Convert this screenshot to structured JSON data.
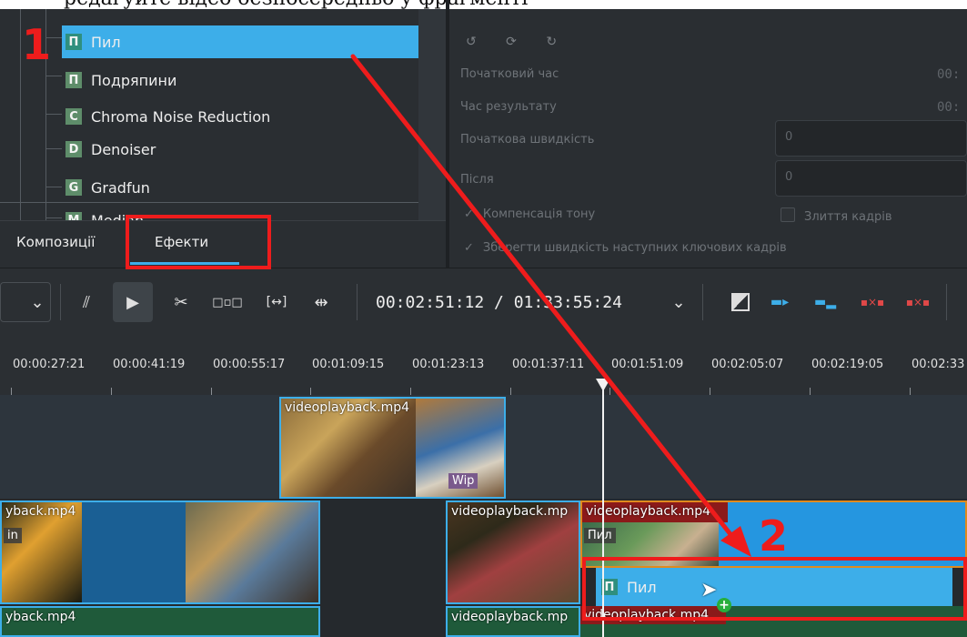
{
  "header_caption": "редагуйте відео безпосередньо у фрагменті",
  "effects_list": {
    "items": [
      {
        "badge": "П",
        "label": "Пил",
        "selected": true
      },
      {
        "badge": "П",
        "label": "Подряпини"
      },
      {
        "badge": "C",
        "label": "Chroma Noise Reduction"
      },
      {
        "badge": "D",
        "label": "Denoiser"
      },
      {
        "badge": "G",
        "label": "Gradfun"
      },
      {
        "badge": "M",
        "label": "Median"
      }
    ]
  },
  "tabs": [
    {
      "label": "Композиції"
    },
    {
      "label": "Ефекти",
      "active": true
    }
  ],
  "properties": {
    "start_time_label": "Початковий час",
    "start_time_value": "00:",
    "result_time_label": "Час результату",
    "result_time_value": "00:",
    "start_speed_label": "Початкова швидкість",
    "start_speed_value": "0",
    "after_label": "Після",
    "after_value": "0",
    "pitch_comp_label": "Компенсація тону",
    "frame_blend_label": "Злиття кадрів",
    "keep_speed_label": "Зберегти швидкість наступних ключових кадрів"
  },
  "toolbar": {
    "timecode": "00:02:51:12 / 01:33:55:24"
  },
  "ruler": {
    "ticks": [
      "00:00:27:21",
      "00:00:41:19",
      "00:00:55:17",
      "00:01:09:15",
      "00:01:23:13",
      "00:01:37:11",
      "00:01:51:09",
      "00:02:05:07",
      "00:02:19:05",
      "00:02:33"
    ]
  },
  "timeline": {
    "clip_v2": "videoplayback.mp4",
    "clip_v2_tag": "Wip",
    "clip_v1a": "yback.mp4",
    "clip_v1a_tag": "in",
    "clip_v1b": "videoplayback.mp",
    "clip_v1c": "videoplayback.mp4",
    "clip_v1c_fx": "Пил",
    "clip_a1a": "yback.mp4",
    "clip_a1b": "videoplayback.mp",
    "clip_a1c": "videoplayback.mp4"
  },
  "drag_ghost": {
    "badge": "П",
    "label": "Пил"
  },
  "annotations": {
    "step1": "1",
    "step2": "2"
  },
  "colors": {
    "accent": "#3daee9",
    "annotation": "#ee1c1c"
  }
}
